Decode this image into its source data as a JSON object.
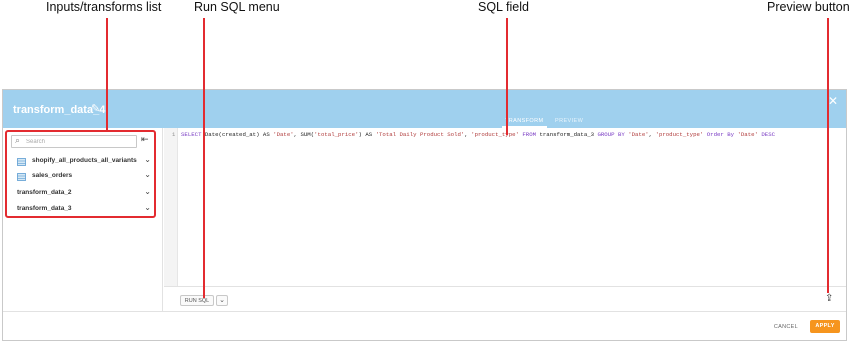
{
  "annotations": {
    "inputs_list": "Inputs/transforms list",
    "run_sql_menu": "Run SQL menu",
    "sql_field": "SQL field",
    "preview_button": "Preview button"
  },
  "dialog": {
    "title": "transform_data_4",
    "tabs": [
      {
        "label": "TRANSFORM",
        "active": true
      },
      {
        "label": "PREVIEW",
        "active": false
      }
    ]
  },
  "sidebar": {
    "search_placeholder": "Search",
    "items": [
      {
        "label": "shopify_all_products_all_variants",
        "table_icon": true
      },
      {
        "label": "sales_orders",
        "table_icon": true
      },
      {
        "label": "transform_data_2",
        "table_icon": false
      },
      {
        "label": "transform_data_3",
        "table_icon": false
      }
    ]
  },
  "editor": {
    "line_number": "1",
    "tokens": {
      "t1": "SELECT",
      "t2": " Date(created_at) AS ",
      "t3": "'Date'",
      "t4": ", SUM(",
      "t5": "'total_price'",
      "t6": ") AS ",
      "t7": "'Total Daily Product Sold'",
      "t8": ", ",
      "t9": "'product_type'",
      "t10": " ",
      "t11": "FROM",
      "t12": " transform_data_3 ",
      "t13": "GROUP BY",
      "t14": " ",
      "t15": "'Date'",
      "t16": ", ",
      "t17": "'product_type'",
      "t18": " ",
      "t19": "Order By",
      "t20": " ",
      "t21": "'Date'",
      "t22": " ",
      "t23": "DESC"
    }
  },
  "toolbar": {
    "run_label": "RUN SQL"
  },
  "footer": {
    "cancel_label": "CANCEL",
    "apply_label": "APPLY"
  },
  "colors": {
    "header": "#9fd0ee",
    "annotation": "#e32b30",
    "apply": "#f6951e",
    "keyword": "#7a3cc4",
    "string": "#b03c3c"
  },
  "icons": {
    "search": "search-icon",
    "collapse": "collapse-panel-icon",
    "edit": "pencil-icon",
    "close": "close-icon",
    "table": "table-icon",
    "chevron": "chevron-down-icon",
    "preview": "upload-icon"
  }
}
